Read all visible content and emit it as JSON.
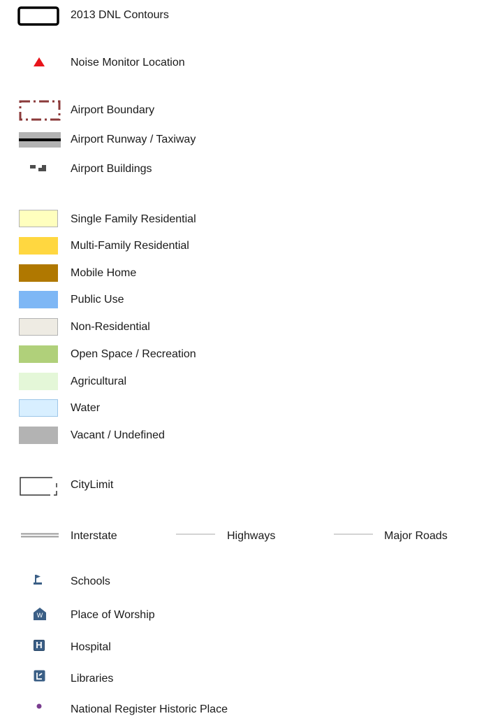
{
  "legend": {
    "items": [
      {
        "label": "2013 DNL Contours",
        "icon": "black-rectangle-outline"
      },
      {
        "label": "Noise Monitor Location",
        "icon": "red-triangle",
        "color": "#e8141b"
      },
      {
        "label": "Airport Boundary",
        "icon": "dash-dot-brown-rectangle",
        "color": "#8b3a3a"
      },
      {
        "label": "Airport Runway / Taxiway",
        "icon": "gray-band-with-black-line",
        "color": "#b3b3b3"
      },
      {
        "label": "Airport Buildings",
        "icon": "building-blocks",
        "color": "#4d4d4d"
      },
      {
        "label": "Single Family Residential",
        "icon": "swatch",
        "color": "#ffffbe"
      },
      {
        "label": "Multi-Family Residential",
        "icon": "swatch",
        "color": "#ffd740"
      },
      {
        "label": "Mobile Home",
        "icon": "swatch",
        "color": "#b07800"
      },
      {
        "label": "Public Use",
        "icon": "swatch",
        "color": "#7eb7f5"
      },
      {
        "label": "Non-Residential",
        "icon": "swatch",
        "color": "#eeebe3"
      },
      {
        "label": "Open Space / Recreation",
        "icon": "swatch",
        "color": "#b0d07a"
      },
      {
        "label": "Agricultural",
        "icon": "swatch",
        "color": "#e4f7d8"
      },
      {
        "label": "Water",
        "icon": "swatch",
        "color": "#d8efff"
      },
      {
        "label": "Vacant / Undefined",
        "icon": "swatch",
        "color": "#b3b3b3"
      },
      {
        "label": "CityLimit",
        "icon": "city-limit-outline"
      },
      {
        "label": "Interstate",
        "icon": "double-gray-line",
        "color": "#999999"
      },
      {
        "label": "Highways",
        "icon": "thin-gray-line",
        "color": "#aaaaaa"
      },
      {
        "label": "Major Roads",
        "icon": "thin-gray-line",
        "color": "#aaaaaa"
      },
      {
        "label": "Schools",
        "icon": "school-flag-icon",
        "color": "#3b5f86"
      },
      {
        "label": "Place of Worship",
        "icon": "worship-house-icon",
        "color": "#3b5f86"
      },
      {
        "label": "Hospital",
        "icon": "hospital-h-icon",
        "color": "#3b5f86"
      },
      {
        "label": "Libraries",
        "icon": "library-book-icon",
        "color": "#3b5f86"
      },
      {
        "label": "National Register Historic Place",
        "icon": "purple-dot",
        "color": "#7a3d8f"
      }
    ],
    "worship_glyph": "W",
    "hospital_glyph": "H"
  }
}
